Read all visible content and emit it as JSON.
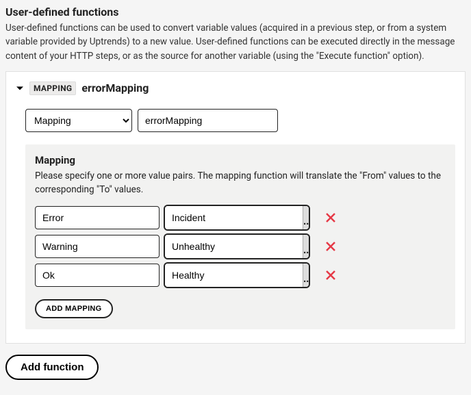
{
  "page": {
    "title": "User-defined functions",
    "description": "User-defined functions can be used to convert variable values (acquired in a previous step, or from a system variable provided by Uptrends) to a new value. User-defined functions can be executed directly in the message content of your HTTP steps, or as the source for another variable (using the \"Execute function\" option)."
  },
  "function": {
    "typeBadge": "MAPPING",
    "name": "errorMapping",
    "typeSelect": {
      "label": "Mapping",
      "options": [
        "Mapping"
      ]
    },
    "nameInputValue": "errorMapping"
  },
  "mapping": {
    "title": "Mapping",
    "description": "Please specify one or more value pairs. The mapping function will translate the \"From\" values to the corresponding \"To\" values.",
    "pairs": [
      {
        "from": "Error",
        "to": "Incident"
      },
      {
        "from": "Warning",
        "to": "Unhealthy"
      },
      {
        "from": "Ok",
        "to": "Healthy"
      }
    ],
    "pickerLabel": "...",
    "addMappingLabel": "ADD MAPPING"
  },
  "footer": {
    "addFunctionLabel": "Add function"
  }
}
